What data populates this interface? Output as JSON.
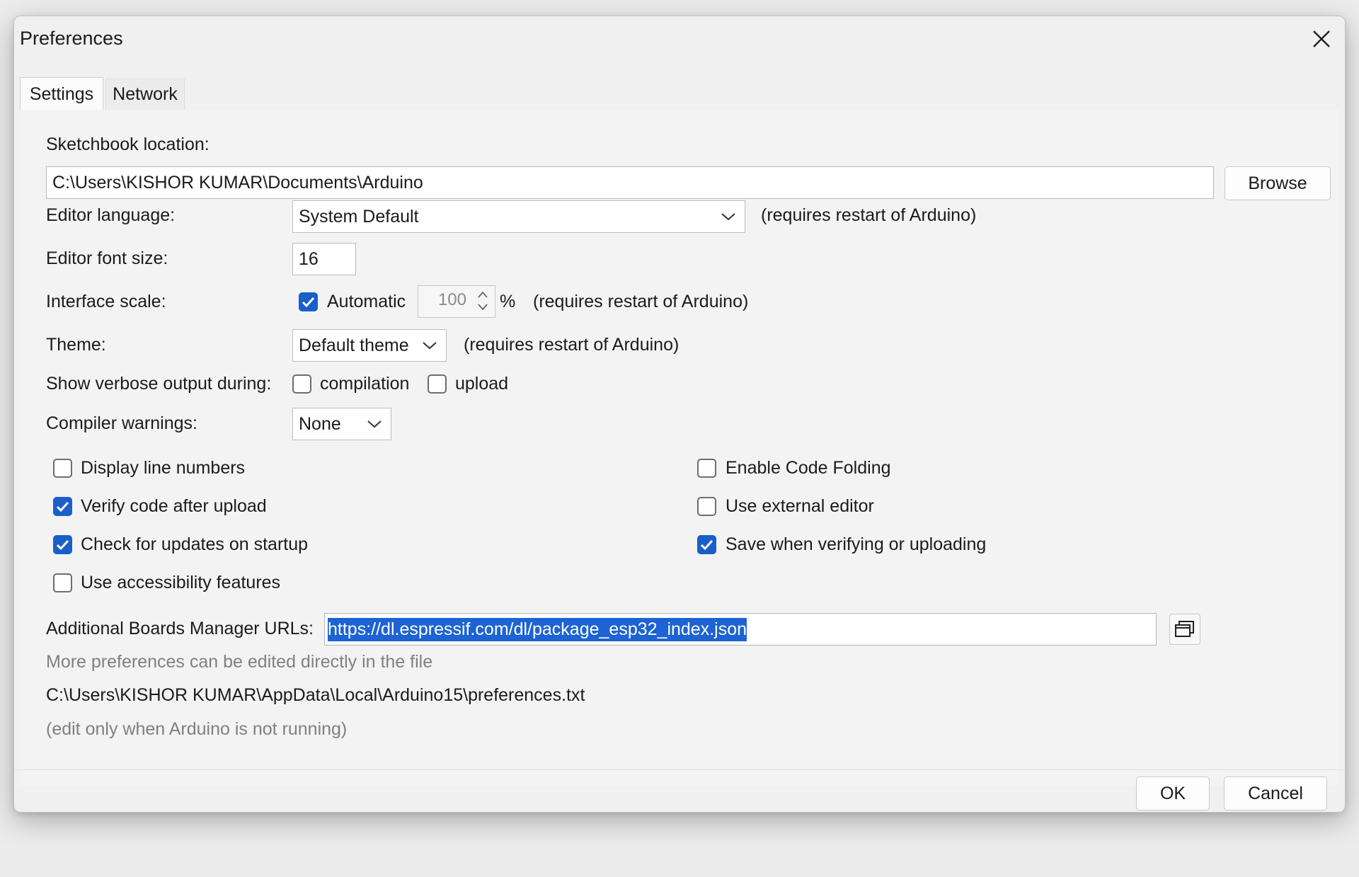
{
  "window": {
    "title": "Preferences"
  },
  "tabs": [
    {
      "label": "Settings",
      "active": true
    },
    {
      "label": "Network",
      "active": false
    }
  ],
  "sketchbook": {
    "label": "Sketchbook location:",
    "value": "C:\\Users\\KISHOR KUMAR\\Documents\\Arduino",
    "browse_label": "Browse"
  },
  "editor_language": {
    "label": "Editor language:",
    "value": "System Default",
    "note": "(requires restart of Arduino)"
  },
  "font_size": {
    "label": "Editor font size:",
    "value": "16"
  },
  "interface_scale": {
    "label": "Interface scale:",
    "automatic_label": "Automatic",
    "automatic_checked": true,
    "value": "100",
    "unit": "%",
    "note": "(requires restart of Arduino)"
  },
  "theme": {
    "label": "Theme:",
    "value": "Default theme",
    "note": "(requires restart of Arduino)"
  },
  "verbose": {
    "label": "Show verbose output during:",
    "compilation_label": "compilation",
    "compilation_checked": false,
    "upload_label": "upload",
    "upload_checked": false
  },
  "compiler_warnings": {
    "label": "Compiler warnings:",
    "value": "None"
  },
  "options_left": [
    {
      "label": "Display line numbers",
      "checked": false
    },
    {
      "label": "Verify code after upload",
      "checked": true
    },
    {
      "label": "Check for updates on startup",
      "checked": true
    },
    {
      "label": "Use accessibility features",
      "checked": false
    }
  ],
  "options_right": [
    {
      "label": "Enable Code Folding",
      "checked": false
    },
    {
      "label": "Use external editor",
      "checked": false
    },
    {
      "label": "Save when verifying or uploading",
      "checked": true
    }
  ],
  "boards_manager": {
    "label": "Additional Boards Manager URLs:",
    "value": "https://dl.espressif.com/dl/package_esp32_index.json",
    "edit_icon": "window-stack-icon"
  },
  "prefs_file": {
    "hint": "More preferences can be edited directly in the file",
    "path": "C:\\Users\\KISHOR KUMAR\\AppData\\Local\\Arduino15\\preferences.txt",
    "note": "(edit only when Arduino is not running)"
  },
  "footer": {
    "ok_label": "OK",
    "cancel_label": "Cancel"
  },
  "colors": {
    "accent": "#1a5fc8",
    "selection": "#1d63d3"
  }
}
